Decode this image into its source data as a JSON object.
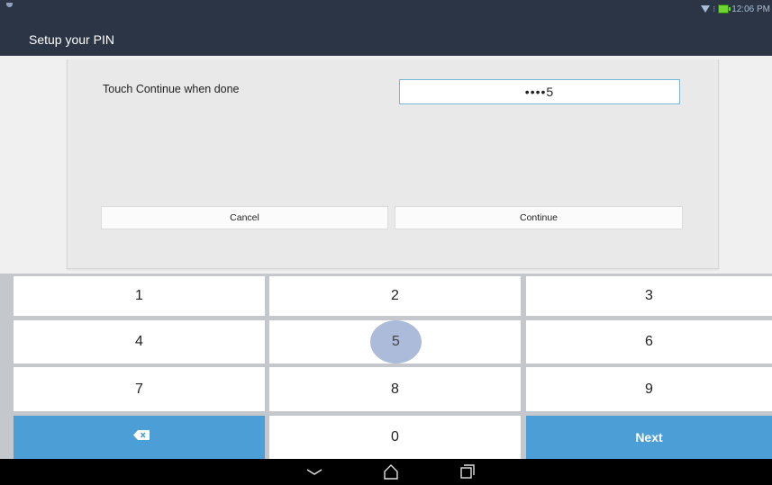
{
  "status_bar": {
    "time": "12:06 PM",
    "icons": [
      "notification-icon",
      "wifi-icon",
      "battery-charging-icon"
    ]
  },
  "app": {
    "title": "Setup your PIN"
  },
  "dialog": {
    "prompt": "Touch Continue when done",
    "pin_display": "••••5",
    "cancel_label": "Cancel",
    "continue_label": "Continue"
  },
  "keypad": {
    "keys": [
      "1",
      "2",
      "3",
      "4",
      "5",
      "6",
      "7",
      "8",
      "9"
    ],
    "zero": "0",
    "next_label": "Next",
    "backspace_icon": "backspace-icon",
    "pressed_key": "5"
  },
  "nav_bar": {
    "icons": [
      "back-icon",
      "home-icon",
      "recent-apps-icon"
    ]
  },
  "colors": {
    "title_bar": "#2c3545",
    "accent_blue": "#4c9fd6",
    "touch_highlight": "#a9b8d9"
  }
}
